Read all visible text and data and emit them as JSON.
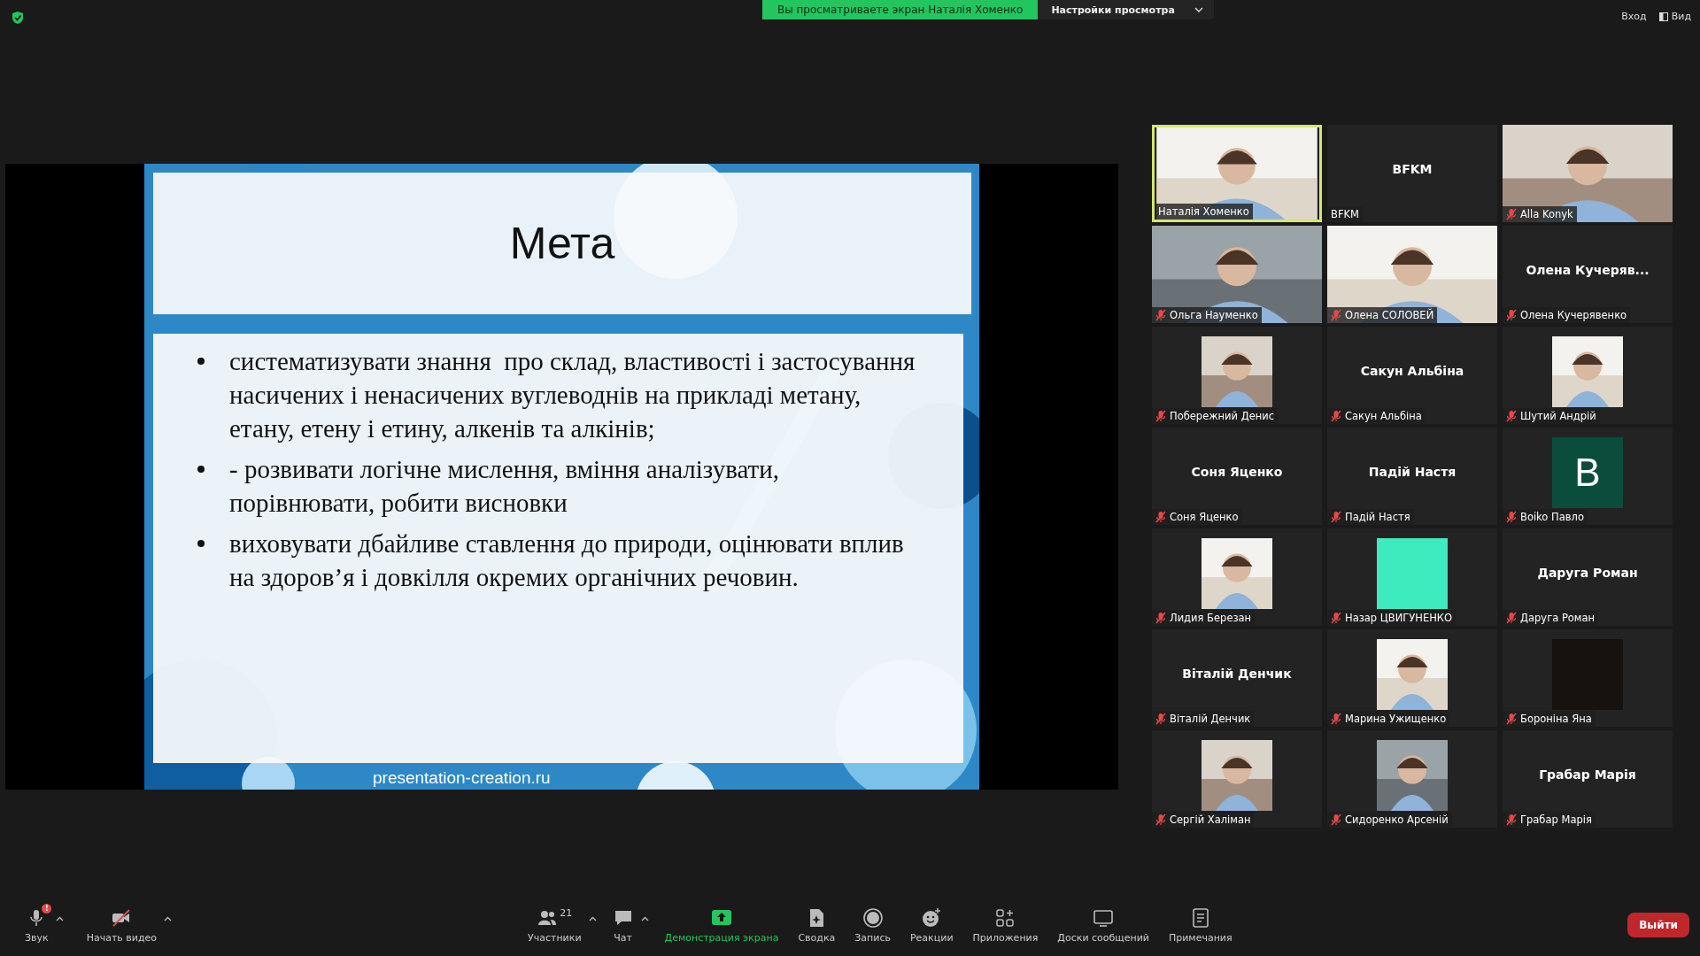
{
  "top_bar": {
    "share_notice": "Вы просматриваете экран Наталія Хоменко",
    "view_options": "Настройки просмотра",
    "sign_in": "Вход",
    "view": "Вид"
  },
  "shared_slide": {
    "title": "Мета",
    "bullets": [
      "систематизувати знання  про склад, властивості і застосування насичених і ненасичених вуглеводнів на прикладі метану, етану, етену і етину, алкенів та алкінів;",
      "- розвивати логічне мислення, вміння аналізувати, порівнювати, робити висновки",
      "виховувати дбайливе ставлення до природи, оцінювати вплив на здоров’я і довкілля окремих органічних речовин."
    ],
    "footer": "presentation-creation.ru"
  },
  "participants": [
    {
      "kind": "video",
      "name": "Наталія Хоменко",
      "muted": false,
      "speaking": true
    },
    {
      "kind": "name",
      "title": "BFKM",
      "name": "BFKM",
      "muted": false,
      "speaking": false
    },
    {
      "kind": "video",
      "name": "Alla Konyk",
      "muted": true,
      "speaking": false
    },
    {
      "kind": "video",
      "name": "Ольга Науменко",
      "muted": true,
      "speaking": false
    },
    {
      "kind": "video",
      "name": "Олена СОЛОВЕЙ",
      "muted": true,
      "speaking": false
    },
    {
      "kind": "name",
      "title": "Олена  Кучеряв...",
      "name": "Олена Кучерявенко",
      "muted": true,
      "speaking": false
    },
    {
      "name": "Побережний Денис",
      "muted": true,
      "speaking": false
    },
    {
      "kind": "name",
      "title": "Сакун Альбіна",
      "name": "Сакун Альбіна",
      "muted": true,
      "speaking": false
    },
    {
      "name": "Шутий Андрій",
      "muted": true,
      "speaking": false
    },
    {
      "kind": "name",
      "title": "Соня Яценко",
      "name": "Соня Яценко",
      "muted": true,
      "speaking": false
    },
    {
      "kind": "name",
      "title": "Падій Настя",
      "name": "Падій Настя",
      "muted": true,
      "speaking": false
    },
    {
      "kind": "letter",
      "letter": "B",
      "color": "#0b4d3c",
      "name": "Boiko Павло",
      "muted": true,
      "speaking": false
    },
    {
      "name": "Лидия Березан",
      "muted": true,
      "speaking": false
    },
    {
      "kind": "color",
      "color": "#3debbf",
      "name": "Назар ЦВИГУНЕНКО",
      "muted": true,
      "speaking": false
    },
    {
      "kind": "name",
      "title": "Даруга Роман",
      "name": "Даруга Роман",
      "muted": true,
      "speaking": false
    },
    {
      "kind": "name",
      "title": "Віталій Денчик",
      "name": "Віталій Денчик",
      "muted": true,
      "speaking": false
    },
    {
      "name": "Марина Ужищенко",
      "muted": true,
      "speaking": false
    },
    {
      "kind": "color",
      "color": "#17110f",
      "name": "Бороніна Яна",
      "muted": true,
      "speaking": false
    },
    {
      "name": "Сергій Халіман",
      "muted": true,
      "speaking": false
    },
    {
      "name": "Сидоренко Арсеній",
      "muted": true,
      "speaking": false
    },
    {
      "kind": "name",
      "title": "Грабар Марія",
      "name": "Грабар Марія",
      "muted": true,
      "speaking": false
    }
  ],
  "toolbar": {
    "left": [
      {
        "kind": "audio",
        "label": "Звук",
        "badge": "!",
        "menu": true,
        "active": false
      },
      {
        "kind": "video",
        "label": "Начать видео",
        "menu": true,
        "active": false
      }
    ],
    "center": [
      {
        "kind": "participants",
        "label": "Участники",
        "count": "21",
        "menu": true,
        "active": false
      },
      {
        "kind": "chat",
        "label": "Чат",
        "menu": true,
        "active": false
      },
      {
        "kind": "share",
        "label": "Демонстрация экрана",
        "menu": false,
        "active": true
      },
      {
        "kind": "summary",
        "label": "Сводка",
        "menu": false,
        "active": false
      },
      {
        "kind": "record",
        "label": "Запись",
        "menu": false,
        "active": false
      },
      {
        "kind": "reactions",
        "label": "Реакции",
        "menu": false,
        "active": false
      },
      {
        "kind": "apps",
        "label": "Приложения",
        "menu": false,
        "active": false
      },
      {
        "kind": "whiteboard",
        "label": "Доски сообщений",
        "menu": false,
        "active": false
      },
      {
        "kind": "notes",
        "label": "Примечания",
        "menu": false,
        "active": false
      }
    ],
    "leave": "Выйти"
  }
}
